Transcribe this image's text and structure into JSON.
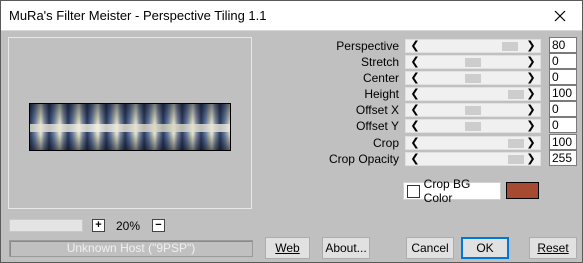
{
  "window": {
    "title": "MuRa's Filter Meister - Perspective Tiling 1.1"
  },
  "icons": {
    "close": "close-icon",
    "scroll_left": "arrow-left-icon",
    "scroll_right": "arrow-right-icon",
    "plus": "plus-icon",
    "minus": "minus-icon"
  },
  "preview": {
    "zoom": "20%",
    "zoom_in_label": "+",
    "zoom_out_label": "−",
    "status": "Unknown Host (\"9PSP\")"
  },
  "params": [
    {
      "label": "Perspective",
      "value": "80"
    },
    {
      "label": "Stretch",
      "value": "0"
    },
    {
      "label": "Center",
      "value": "0"
    },
    {
      "label": "Height",
      "value": "100"
    },
    {
      "label": "Offset X",
      "value": "0"
    },
    {
      "label": "Offset Y",
      "value": "0"
    },
    {
      "label": "Crop",
      "value": "100"
    },
    {
      "label": "Crop Opacity",
      "value": "255"
    }
  ],
  "crop_bg": {
    "label": "Crop BG Color",
    "checked": false,
    "color": "#a64b31"
  },
  "buttons": {
    "web": "Web",
    "about": "About...",
    "cancel": "Cancel",
    "ok": "OK",
    "reset": "Reset"
  },
  "colors": {
    "dialog_bg": "#c0c0c0",
    "accent": "#0078d7",
    "swatch": "#a64b31"
  }
}
